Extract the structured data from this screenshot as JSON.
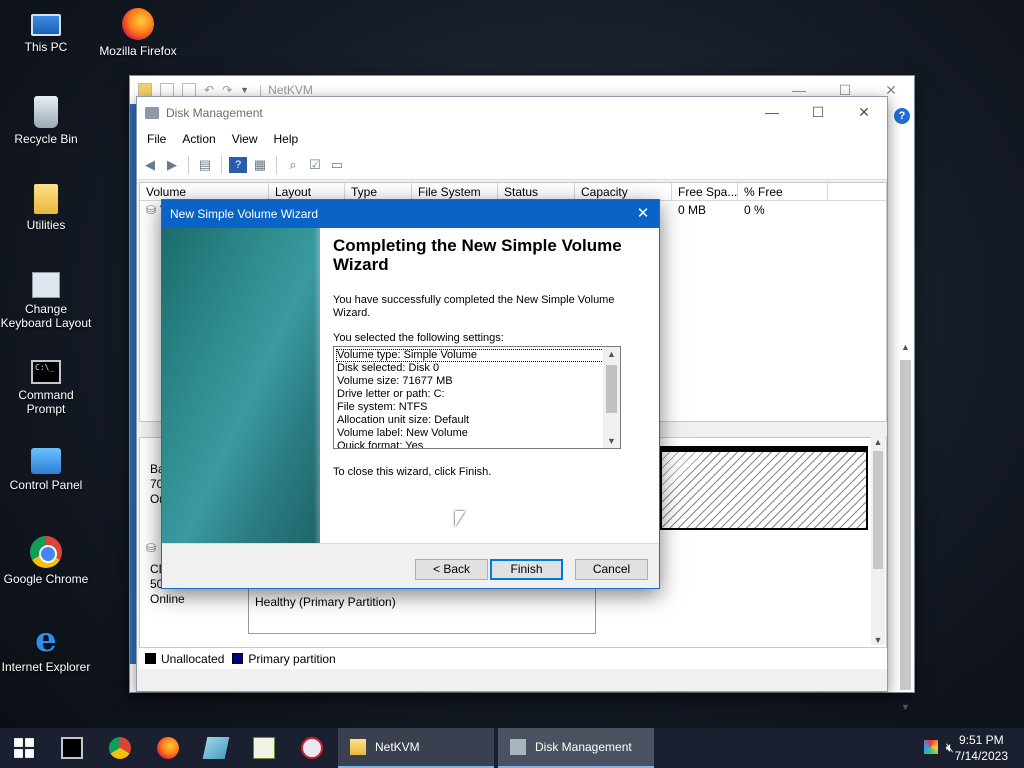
{
  "desktop": {
    "icons": [
      {
        "label": "This PC"
      },
      {
        "label": "Mozilla Firefox"
      },
      {
        "label": "Recycle Bin"
      },
      {
        "label": "Utilities"
      },
      {
        "label": "Change Keyboard Layout"
      },
      {
        "label": "Command Prompt"
      },
      {
        "label": "Control Panel"
      },
      {
        "label": "Google Chrome"
      },
      {
        "label": "Internet Explorer"
      }
    ]
  },
  "explorer": {
    "title": "NetKVM",
    "help_glyph": "?"
  },
  "disk_management": {
    "title": "Disk Management",
    "menu": [
      "File",
      "Action",
      "View",
      "Help"
    ],
    "columns": [
      "Volume",
      "Layout",
      "Type",
      "File System",
      "Status",
      "Capacity",
      "Free Spa...",
      "% Free"
    ],
    "volume_row": {
      "free_space": "0 MB",
      "percent_free": "0 %",
      "volume_partial": "V"
    },
    "disk0": {
      "line1": "Ba",
      "line2": "70.",
      "line3": "On"
    },
    "cdrom": {
      "line1": "CD",
      "line2": "50",
      "line3": "Online"
    },
    "partition_status": "Healthy (Primary Partition)",
    "legend": [
      {
        "label": "Unallocated",
        "color": "#000000"
      },
      {
        "label": "Primary partition",
        "color": "#000080"
      }
    ]
  },
  "wizard": {
    "title": "New Simple Volume Wizard",
    "heading": "Completing the New Simple Volume Wizard",
    "success_text": "You have successfully completed the New Simple Volume Wizard.",
    "selected_label": "You selected the following settings:",
    "settings": [
      "Volume type: Simple Volume",
      "Disk selected: Disk 0",
      "Volume size: 71677 MB",
      "Drive letter or path: C:",
      "File system: NTFS",
      "Allocation unit size: Default",
      "Volume label: New Volume",
      "Quick format: Yes"
    ],
    "close_hint": "To close this wizard, click Finish.",
    "buttons": {
      "back": "< Back",
      "finish": "Finish",
      "cancel": "Cancel"
    }
  },
  "taskbar": {
    "items": [
      {
        "label": "NetKVM"
      },
      {
        "label": "Disk Management"
      }
    ],
    "time": "9:51 PM",
    "date": "7/14/2023"
  }
}
